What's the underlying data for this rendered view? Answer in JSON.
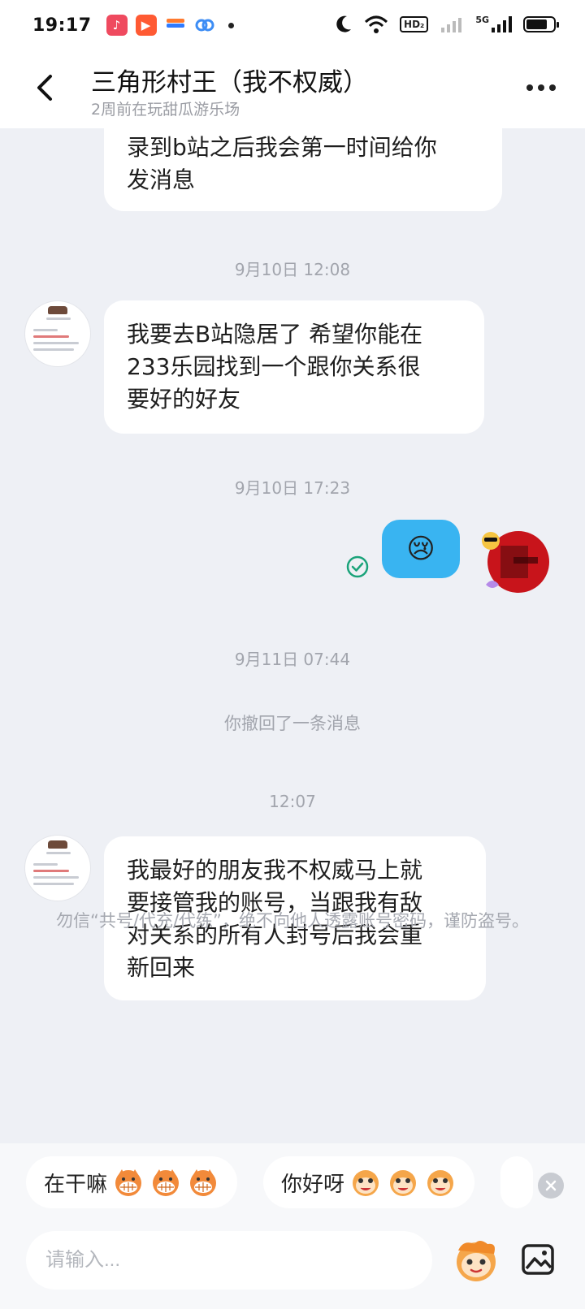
{
  "status_bar": {
    "time": "19:17",
    "hd_label": "HD₂",
    "network_label": "5G",
    "icons": [
      "music-icon",
      "video-play-icon",
      "wallet-icon",
      "link-icon",
      "moon-icon",
      "wifi-icon",
      "signal-icon",
      "battery-icon"
    ],
    "battery_level": 0.8
  },
  "header": {
    "title": "三角形村王（我不权威）",
    "subtitle": "2周前在玩甜瓜游乐场"
  },
  "messages": [
    {
      "side": "left",
      "text_lines": [
        "录到b站之后我会第一时间给你",
        "发消息"
      ]
    },
    {
      "timestamp": "9月10日 12:08"
    },
    {
      "side": "left",
      "text_lines": [
        "我要去B站隐居了 希望你能在",
        "233乐园找到一个跟你关系很",
        "要好的好友"
      ]
    },
    {
      "timestamp": "9月10日 17:23"
    },
    {
      "side": "right",
      "emoji": "😢",
      "status": "read"
    },
    {
      "timestamp": "9月11日 07:44"
    },
    {
      "system": "你撤回了一条消息"
    },
    {
      "timestamp": "12:07"
    },
    {
      "side": "left",
      "text_lines": [
        "我最好的朋友我不权威马上就",
        "要接管我的账号，当跟我有敌",
        "对关系的所有人封号后我会重",
        "新回来"
      ]
    }
  ],
  "notice": "勿信“共号/代充/代练”，绝不向他人透露账号密码，谨防盗号。",
  "quick_replies": [
    {
      "label": "在干嘛"
    },
    {
      "label": "你好呀"
    }
  ],
  "input": {
    "placeholder": "请输入..."
  },
  "colors": {
    "background": "#eef0f5",
    "sent_bubble": "#39b4f1",
    "read_check": "#1aa37a"
  }
}
